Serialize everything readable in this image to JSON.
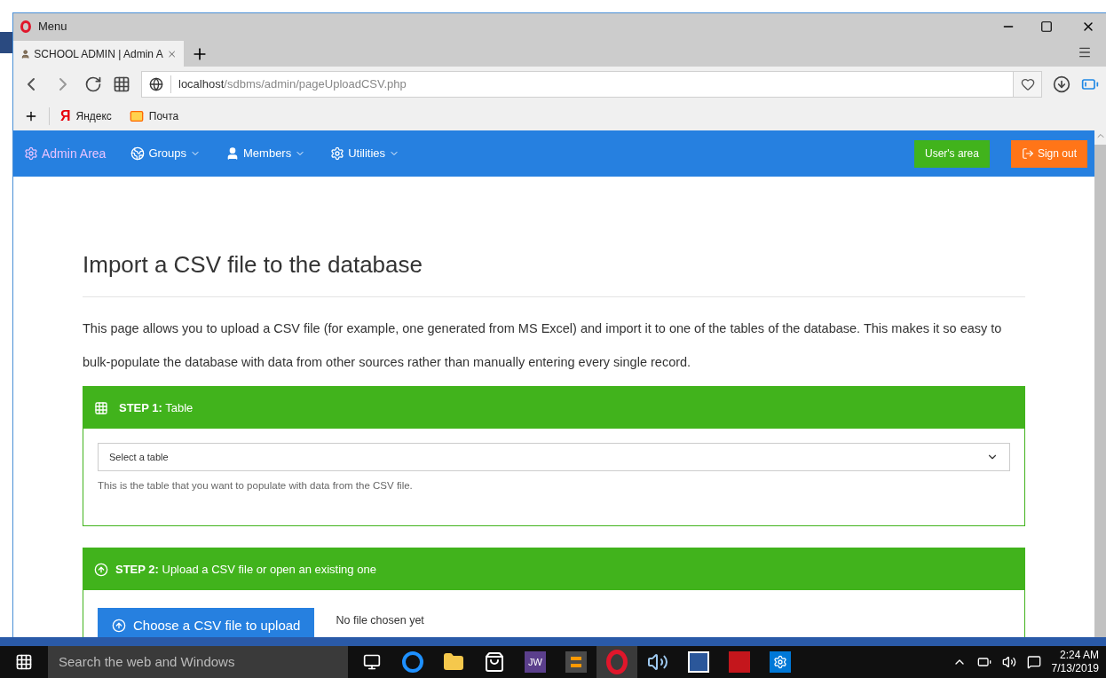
{
  "browser": {
    "menu_label": "Menu",
    "tab_title": "SCHOOL ADMIN | Admin A",
    "url_host": "localhost",
    "url_path": "/sdbms/admin/pageUploadCSV.php",
    "bookmarks": [
      {
        "label": "Яндекс",
        "logo": "Я"
      },
      {
        "label": "Почта"
      }
    ]
  },
  "navbar": {
    "brand": "Admin Area",
    "menus": [
      {
        "label": "Groups"
      },
      {
        "label": "Members"
      },
      {
        "label": "Utilities"
      }
    ],
    "users_area_button": "User's area",
    "sign_out_button": "Sign out"
  },
  "page": {
    "title": "Import a CSV file to the database",
    "intro": "This page allows you to upload a CSV file (for example, one generated from MS Excel) and import it to one of the tables of the database. This makes it so easy to bulk-populate the database with data from other sources rather than manually entering every single record.",
    "step1": {
      "heading": "**STEP 1:** Table",
      "select_placeholder": "Select a table",
      "help": "This is the table that you want to populate with data from the CSV file."
    },
    "step2": {
      "heading": "**STEP 2:** Upload a CSV file or open an existing one",
      "button": "Choose a CSV file to upload",
      "status": "No file chosen yet"
    }
  },
  "taskbar": {
    "search_placeholder": "Search the web and Windows",
    "apps": [
      {
        "kind": "taskview",
        "selected": false
      },
      {
        "kind": "edge",
        "selected": false
      },
      {
        "kind": "explorer",
        "selected": false
      },
      {
        "kind": "store",
        "selected": false
      },
      {
        "kind": "text",
        "label": "JW",
        "selected": false
      },
      {
        "kind": "sublime",
        "selected": false
      },
      {
        "kind": "opera",
        "selected": true
      },
      {
        "kind": "audio",
        "selected": false
      },
      {
        "kind": "word",
        "selected": false
      },
      {
        "kind": "acrobat",
        "selected": false
      },
      {
        "kind": "settings",
        "selected": false
      }
    ],
    "time": "2:24 AM",
    "date": "7/13/2019"
  }
}
